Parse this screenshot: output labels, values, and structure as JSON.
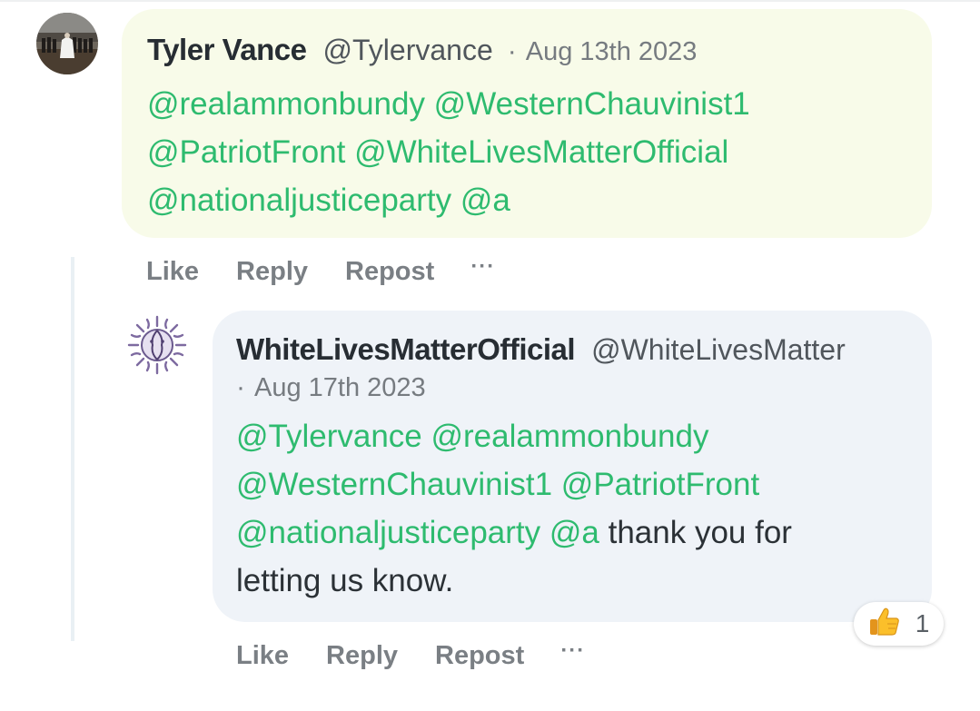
{
  "post": {
    "author_name": "Tyler Vance",
    "author_handle": "@Tylervance",
    "separator": "·",
    "date": "Aug 13th 2023",
    "mentions_line1": "@realammonbundy @WesternChauvinist1",
    "mentions_line2": "@PatriotFront @WhiteLivesMatterOfficial",
    "mentions_line3": "@nationaljusticeparty @a",
    "actions": {
      "like": "Like",
      "reply": "Reply",
      "repost": "Repost",
      "more": "···"
    }
  },
  "reply": {
    "author_name": "WhiteLivesMatterOfficial",
    "author_handle": "@WhiteLivesMatter",
    "separator": "·",
    "date": "Aug 17th 2023",
    "mentions_line1": "@Tylervance @realammonbundy",
    "mentions_line2": "@WesternChauvinist1 @PatriotFront",
    "mentions_line3": "@nationaljusticeparty @a",
    "text_tail": " thank you for",
    "text_line4": "letting us know.",
    "reaction": {
      "icon": "thumbs-up-icon",
      "count": "1"
    },
    "actions": {
      "like": "Like",
      "reply": "Reply",
      "repost": "Repost",
      "more": "···"
    }
  },
  "colors": {
    "mention": "#2ebb6f",
    "main_bubble": "#f8fbe9",
    "reply_bubble": "#eff3f8",
    "action_text": "#7a7f84"
  }
}
